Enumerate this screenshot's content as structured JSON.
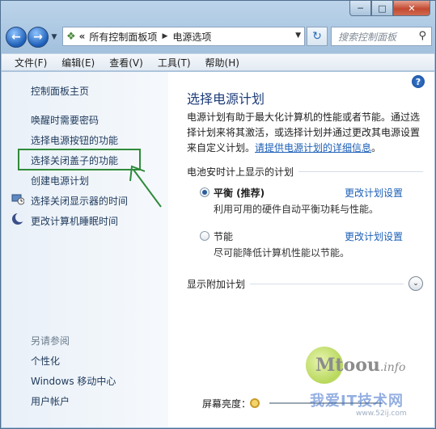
{
  "nav": {
    "breadcrumb_root": "所有控制面板项",
    "breadcrumb_current": "电源选项",
    "search_placeholder": "搜索控制面板"
  },
  "menu": [
    "文件(F)",
    "编辑(E)",
    "查看(V)",
    "工具(T)",
    "帮助(H)"
  ],
  "left": {
    "home": "控制面板主页",
    "items": [
      "唤醒时需要密码",
      "选择电源按钮的功能",
      "选择关闭盖子的功能",
      "创建电源计划",
      "选择关闭显示器的时间",
      "更改计算机睡眠时间"
    ],
    "see_also": "另请参阅",
    "see_also_items": [
      "个性化",
      "Windows 移动中心",
      "用户帐户"
    ]
  },
  "main": {
    "title": "选择电源计划",
    "desc": "电源计划有助于最大化计算机的性能或者节能。通过选择计划来将其激活，或选择计划并通过更改其电源设置来自定义计划。",
    "desc_link": "请提供电源计划的详细信息",
    "desc_end": "。",
    "group_header": "电池安时计上显示的计划",
    "plans": [
      {
        "name": "平衡 (推荐)",
        "desc": "利用可用的硬件自动平衡功耗与性能。",
        "link": "更改计划设置",
        "selected": true
      },
      {
        "name": "节能",
        "desc": "尽可能降低计算机性能以节能。",
        "link": "更改计划设置",
        "selected": false
      }
    ],
    "show_more": "显示附加计划",
    "brightness_label": "屏幕亮度："
  },
  "watermark": {
    "brand": "Mtoou",
    "brand_suffix": ".info",
    "cn": "我爱IT技术网",
    "url": "www.52ij.com"
  },
  "colors": {
    "highlight": "#2f8a3a",
    "link": "#1b5fb7",
    "title": "#1e3d7a"
  }
}
